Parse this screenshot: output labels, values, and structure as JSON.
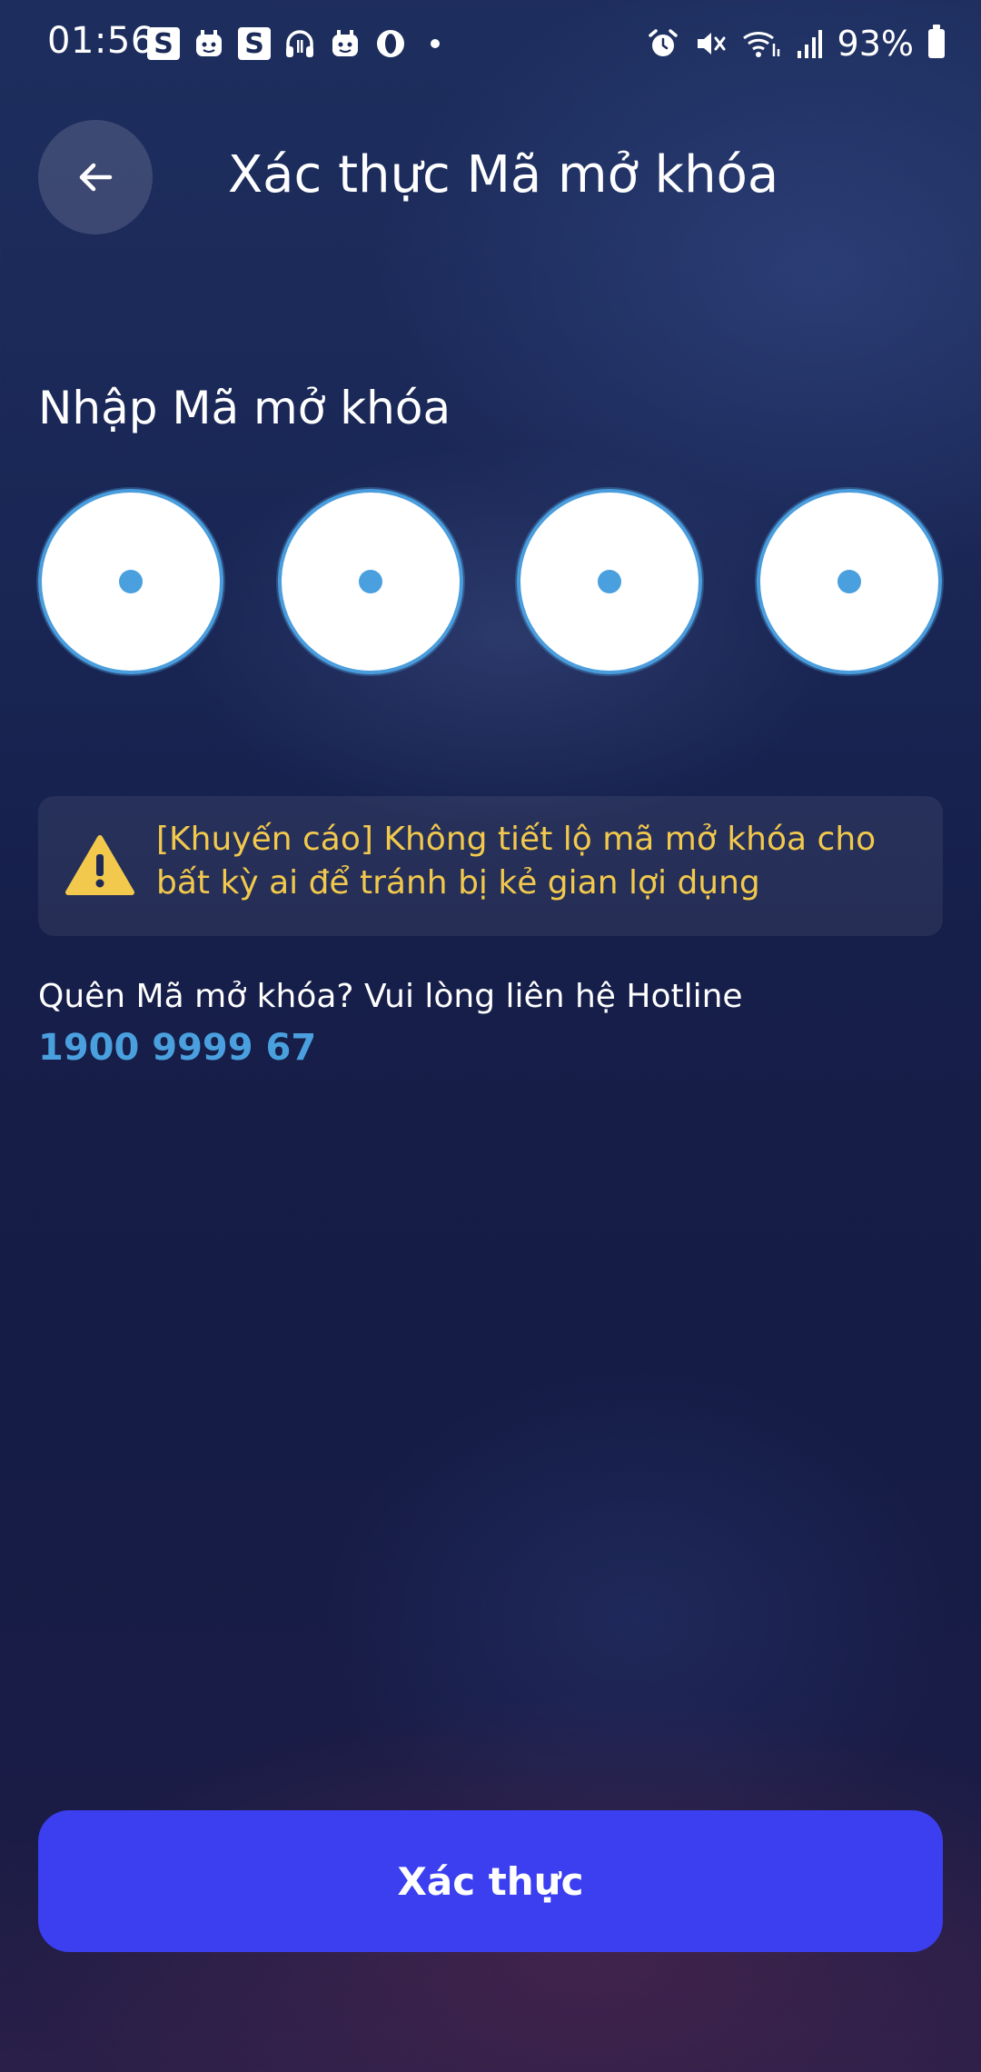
{
  "status_bar": {
    "time": "01:56",
    "battery": "93%",
    "notification_icons": [
      "s-icon",
      "face-icon",
      "s-icon",
      "headphones-icon",
      "face-icon",
      "o-icon",
      "dot-icon"
    ],
    "system_icons": [
      "alarm-icon",
      "mute-icon",
      "wifi-icon",
      "signal-icon",
      "battery-icon"
    ]
  },
  "header": {
    "back_icon": "arrow-left-icon",
    "title": "Xác thực Mã mở khóa"
  },
  "pin": {
    "label": "Nhập Mã mở khóa",
    "length": 4,
    "entered": 4
  },
  "warning": {
    "icon": "warning-triangle-icon",
    "text": "[Khuyến cáo] Không tiết lộ mã mở khóa cho bất kỳ ai để tránh bị kẻ gian lợi dụng"
  },
  "help": {
    "text": "Quên Mã mở khóa? Vui lòng liên hệ Hotline",
    "hotline": "1900 9999 67"
  },
  "submit": {
    "label": "Xác thực"
  },
  "colors": {
    "accent_blue": "#4aa0de",
    "button": "#3b3ff0",
    "warning": "#f2c94c"
  }
}
